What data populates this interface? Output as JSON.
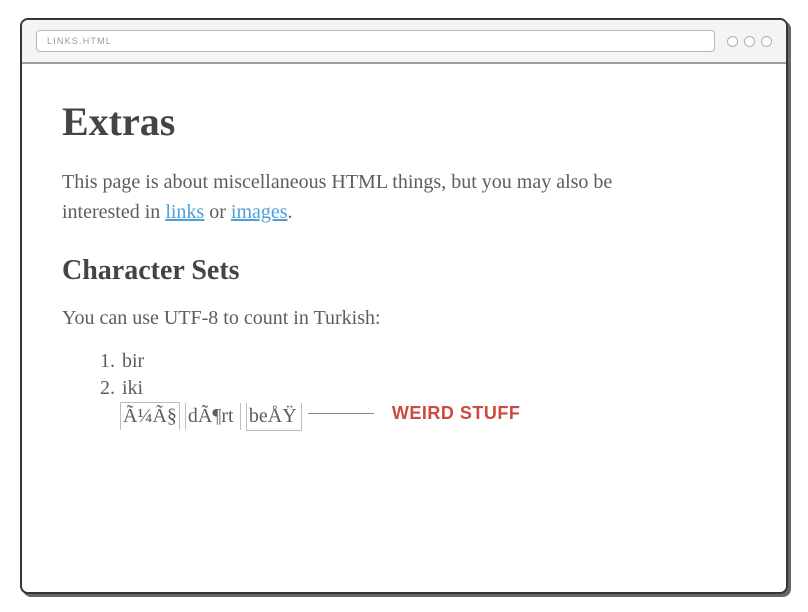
{
  "chrome": {
    "url_display": "LINKS.HTML"
  },
  "page": {
    "heading": "Extras",
    "intro_pre": "This page is about miscellaneous HTML things, but you may also be interested in ",
    "intro_link1": "links",
    "intro_mid": " or ",
    "intro_link2": "images",
    "intro_post": ".",
    "subheading": "Character Sets",
    "subtext": "You can use UTF-8 to count in Turkish:",
    "items": {
      "0": "bir",
      "1": "iki",
      "2": "Ã¼Ã§",
      "3": "dÃ¶rt",
      "4": "beÅŸ"
    },
    "annotation": "WEIRD STUFF"
  }
}
